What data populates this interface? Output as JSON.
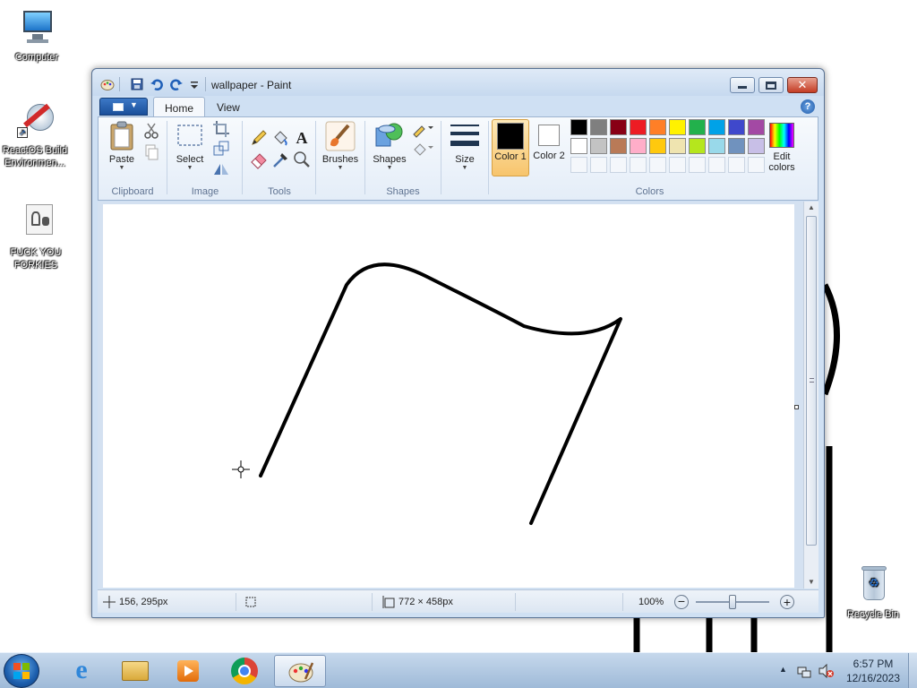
{
  "desktop": {
    "icons": [
      {
        "label": "Computer"
      },
      {
        "label": "ReactOS Build Environmen..."
      },
      {
        "label": "FUCK YOU FORKIES"
      },
      {
        "label": "Recycle Bin"
      }
    ]
  },
  "paint": {
    "title": "wallpaper - Paint",
    "tabs": {
      "home": "Home",
      "view": "View"
    },
    "help": "?",
    "groups": {
      "clipboard": "Clipboard",
      "image": "Image",
      "tools": "Tools",
      "shapes": "Shapes",
      "colors": "Colors"
    },
    "buttons": {
      "paste": "Paste",
      "select": "Select",
      "brushes": "Brushes",
      "shapes": "Shapes",
      "size": "Size",
      "color1": "Color 1",
      "color2": "Color 2",
      "edit_colors": "Edit colors"
    },
    "text_tool": "A",
    "color1": "#000000",
    "color2": "#ffffff",
    "palette_row1": [
      "#000000",
      "#7f7f7f",
      "#880015",
      "#ed1c24",
      "#ff7f27",
      "#fff200",
      "#22b14c",
      "#00a2e8",
      "#3f48cc",
      "#a349a4"
    ],
    "palette_row2": [
      "#ffffff",
      "#c3c3c3",
      "#b97a57",
      "#ffaec9",
      "#ffc90e",
      "#efe4b0",
      "#b5e61d",
      "#99d9ea",
      "#7092be",
      "#c8bfe7"
    ],
    "status": {
      "cursor_pos": "156, 295px",
      "canvas_size": "772 × 458px",
      "zoom": "100%",
      "zoom_level": 100
    }
  },
  "taskbar": {
    "apps": [
      "Internet Explorer",
      "Windows Explorer",
      "Media Player",
      "Chrome",
      "Paint"
    ],
    "time": "6:57 PM",
    "date": "12/16/2023"
  }
}
